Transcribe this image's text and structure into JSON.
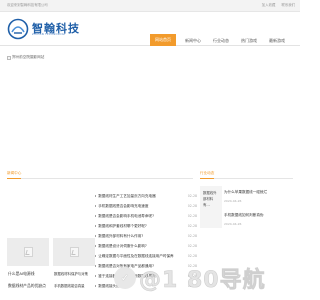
{
  "topbar": {
    "left_text": "欢迎来到智翰科技有限公司",
    "right_links": [
      "加入收藏",
      "联系我们"
    ]
  },
  "header": {
    "logo_text": "智翰科技",
    "logo_sub": "ZHIHAN TECHNOLOGY",
    "nav": [
      {
        "label": "网站首页",
        "active": true
      },
      {
        "label": "新闻中心",
        "active": false
      },
      {
        "label": "行业动态",
        "active": false
      },
      {
        "label": "热门游戏",
        "active": false
      },
      {
        "label": "最新游戏",
        "active": false
      }
    ]
  },
  "banner": {
    "alt": "郑州前空院摄影网站"
  },
  "news_section": {
    "title": "新闻中心",
    "thumbs": [
      {
        "caption": "什么是AI电源线"
      },
      {
        "caption": "数据线材产品的优缺点"
      }
    ],
    "list": [
      {
        "title": "数据线材生产工艺加量页方向充电器",
        "date": "02-28"
      },
      {
        "title": "手机数据线是否会影响充电速度",
        "date": "02-28"
      },
      {
        "title": "数据线是否会影响手机电池寿命呢?",
        "date": "02-28"
      },
      {
        "title": "数据线和护套线材哪个更好呢?",
        "date": "02-28"
      },
      {
        "title": "数据线外部材料有什么作用?",
        "date": "02-28"
      },
      {
        "title": "数据线是设计对伺服什么影响?",
        "date": "02-28"
      },
      {
        "title": "让确定数据与平面性及在数据线连接用户时保养",
        "date": "02-28"
      },
      {
        "title": "数据线是否对所有家电产品都通用?",
        "date": "02-28"
      },
      {
        "title": "鉴于连接器了解怎么判断数据线质量",
        "date": "02-28"
      },
      {
        "title": "数据线接头的分类",
        "date": "02-28"
      }
    ],
    "small_items": [
      "数据线材料保护与对策",
      "手机数据线能否真量"
    ]
  },
  "industry_section": {
    "title": "行业动态",
    "side_text": "数据线外部材料有…",
    "items": [
      {
        "title": "为什么苹果数据线一碰就烂",
        "date": "2024-04-26"
      },
      {
        "title": "手机数据线如何判断真伪",
        "date": "2024-04-26"
      }
    ]
  },
  "watermark": {
    "text": "@1 80导航"
  }
}
